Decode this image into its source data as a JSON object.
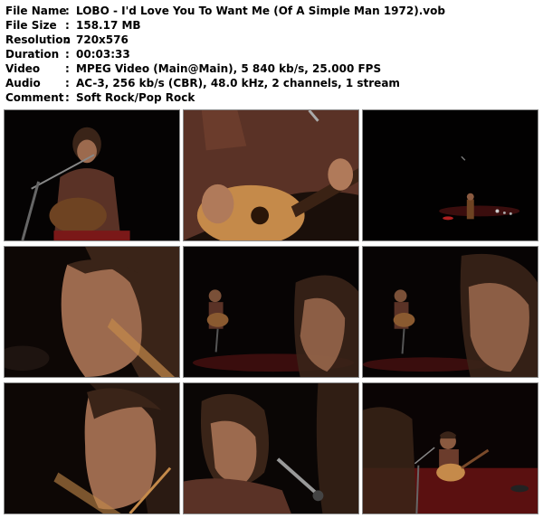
{
  "file_info": {
    "rows": [
      {
        "key": "File Name",
        "sep": ":",
        "value": "LOBO - I'd Love You To Want Me (Of A Simple Man 1972).vob"
      },
      {
        "key": "File Size",
        "sep": ":",
        "value": "158.17 MB"
      },
      {
        "key": "Resolution",
        "sep": ":",
        "value": "720x576"
      },
      {
        "key": "Duration",
        "sep": ":",
        "value": "00:03:33"
      },
      {
        "key": "Video",
        "sep": ":",
        "value": "MPEG Video (Main@Main), 5 840 kb/s, 25.000 FPS"
      },
      {
        "key": "Audio",
        "sep": ":",
        "value": "AC-3, 256 kb/s (CBR), 48.0 kHz, 2 channels, 1 stream"
      },
      {
        "key": "Comment",
        "sep": ":",
        "value": "Soft Rock/Pop Rock"
      }
    ]
  },
  "thumbnails": [
    {
      "scene": "guitarist-with-microphone"
    },
    {
      "scene": "hands-on-guitar-closeup"
    },
    {
      "scene": "dark-stage-wide-shot"
    },
    {
      "scene": "face-profile-closeup"
    },
    {
      "scene": "stage-performer-with-face-overlay"
    },
    {
      "scene": "stage-performer-with-face-overlay"
    },
    {
      "scene": "face-closeup-eyes-closed"
    },
    {
      "scene": "performer-with-face-overlay-microphone"
    },
    {
      "scene": "performer-with-guitar-red-stage"
    }
  ],
  "colors": {
    "frame_bg": "#000000",
    "frame_border": "#8a8a8a",
    "skin": "#9c6a4e",
    "hair": "#3a2418",
    "shirt": "#5a3226",
    "guitar": "#c58a4a",
    "stage_red": "#7a1818"
  }
}
